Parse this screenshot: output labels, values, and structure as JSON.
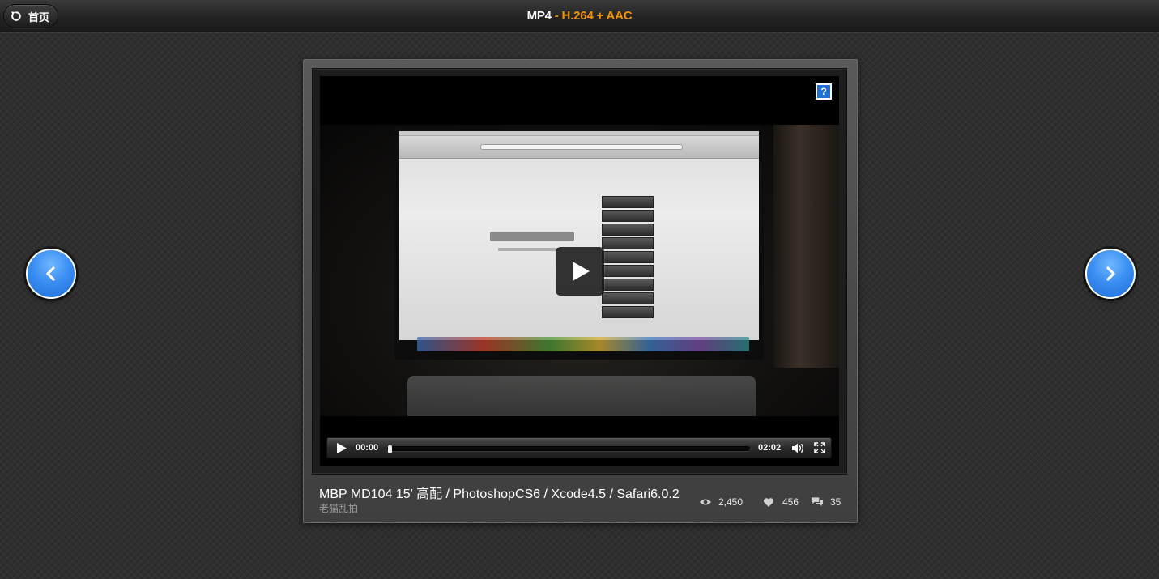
{
  "header": {
    "home_label": "首页",
    "title_format": "MP4",
    "title_codec": " - H.264 + AAC"
  },
  "video": {
    "help_label": "?",
    "current_time": "00:00",
    "duration": "02:02",
    "progress_fraction": 0.0
  },
  "info": {
    "title": "MBP MD104 15′ 高配 / PhotoshopCS6 / Xcode4.5 / Safari6.0.2",
    "author": "老猫乱拍"
  },
  "stats": {
    "views": "2,450",
    "likes": "456",
    "comments": "35"
  },
  "colors": {
    "accent_orange": "#f29400",
    "nav_blue": "#3b8ff2"
  },
  "icons": {
    "home": "back-arrow-icon",
    "prev": "chevron-left-icon",
    "next": "chevron-right-icon",
    "play": "play-icon",
    "volume": "volume-icon",
    "fullscreen": "fullscreen-icon",
    "views": "eye-icon",
    "likes": "heart-icon",
    "comments": "comment-icon"
  }
}
